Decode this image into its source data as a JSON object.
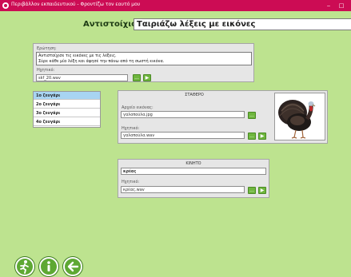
{
  "window": {
    "title": "Περιβάλλον εκπαιδευτικού - Φροντίζω τον εαυτό μου",
    "min_label": "‒",
    "max_label": "□",
    "titlebar_color": "#cc0c54",
    "background_color": "#bde38f"
  },
  "header": {
    "label": "Αντιστοίχιση:",
    "title": "Ταιριάζω λέξεις με εικόνες"
  },
  "question": {
    "label": "Ερώτηση:",
    "line1": "Αντιστοίχισε τις εικόνες με τις λέξεις.",
    "line2": "Σύρε κάθε μία λέξη και άφησέ την πάνω από τη σωστή εικόνα.",
    "audio_label": "Ηχητικό:",
    "audio_value": "skf_20.wav",
    "more_label": "...",
    "play_label": "▶"
  },
  "pairs": [
    "1o ζευγάρι",
    "2o ζευγάρι",
    "3o ζευγάρι",
    "4o ζευγάρι"
  ],
  "fixed": {
    "heading": "ΣΤΑΘΕΡΟ",
    "image_label": "Αρχείο εικόνας:",
    "image_value": "γαλοπούλα.jpg",
    "audio_label": "Ηχητικό:",
    "audio_value": "γαλοπούλα.wav",
    "more_label": "...",
    "play_label": "▶",
    "image_icon": "turkey-image"
  },
  "moving": {
    "heading": "ΚΙΝΗΤΟ",
    "word_value": "κρέας",
    "audio_label": "Ηχητικό:",
    "audio_value": "κρέας.wav",
    "more_label": "...",
    "play_label": "▶"
  },
  "bottom": {
    "exit_icon": "running-man-icon",
    "info_icon": "info-icon",
    "back_icon": "back-arrow-icon"
  }
}
